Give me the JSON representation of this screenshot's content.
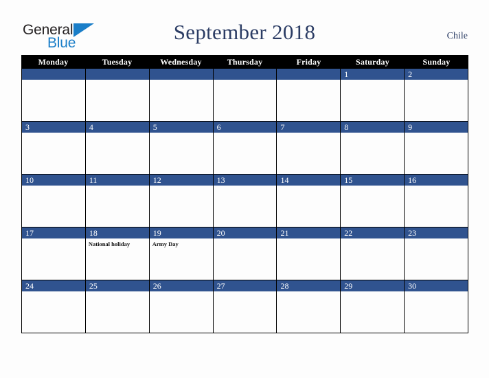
{
  "brand": {
    "name_part1": "General",
    "name_part2": "Blue",
    "triangle_icon": "blue-triangle-icon",
    "color_dark": "#231f20",
    "color_blue": "#1a7ec8"
  },
  "header": {
    "title": "September 2018",
    "country": "Chile",
    "title_color": "#2b3c64"
  },
  "calendar": {
    "accent_color": "#30538f",
    "header_bg": "#000000",
    "weekdays": [
      "Monday",
      "Tuesday",
      "Wednesday",
      "Thursday",
      "Friday",
      "Saturday",
      "Sunday"
    ],
    "weeks": [
      [
        {
          "day": "",
          "events": []
        },
        {
          "day": "",
          "events": []
        },
        {
          "day": "",
          "events": []
        },
        {
          "day": "",
          "events": []
        },
        {
          "day": "",
          "events": []
        },
        {
          "day": "1",
          "events": []
        },
        {
          "day": "2",
          "events": []
        }
      ],
      [
        {
          "day": "3",
          "events": []
        },
        {
          "day": "4",
          "events": []
        },
        {
          "day": "5",
          "events": []
        },
        {
          "day": "6",
          "events": []
        },
        {
          "day": "7",
          "events": []
        },
        {
          "day": "8",
          "events": []
        },
        {
          "day": "9",
          "events": []
        }
      ],
      [
        {
          "day": "10",
          "events": []
        },
        {
          "day": "11",
          "events": []
        },
        {
          "day": "12",
          "events": []
        },
        {
          "day": "13",
          "events": []
        },
        {
          "day": "14",
          "events": []
        },
        {
          "day": "15",
          "events": []
        },
        {
          "day": "16",
          "events": []
        }
      ],
      [
        {
          "day": "17",
          "events": []
        },
        {
          "day": "18",
          "events": [
            "National holiday"
          ]
        },
        {
          "day": "19",
          "events": [
            "Army Day"
          ]
        },
        {
          "day": "20",
          "events": []
        },
        {
          "day": "21",
          "events": []
        },
        {
          "day": "22",
          "events": []
        },
        {
          "day": "23",
          "events": []
        }
      ],
      [
        {
          "day": "24",
          "events": []
        },
        {
          "day": "25",
          "events": []
        },
        {
          "day": "26",
          "events": []
        },
        {
          "day": "27",
          "events": []
        },
        {
          "day": "28",
          "events": []
        },
        {
          "day": "29",
          "events": []
        },
        {
          "day": "30",
          "events": []
        }
      ]
    ]
  }
}
